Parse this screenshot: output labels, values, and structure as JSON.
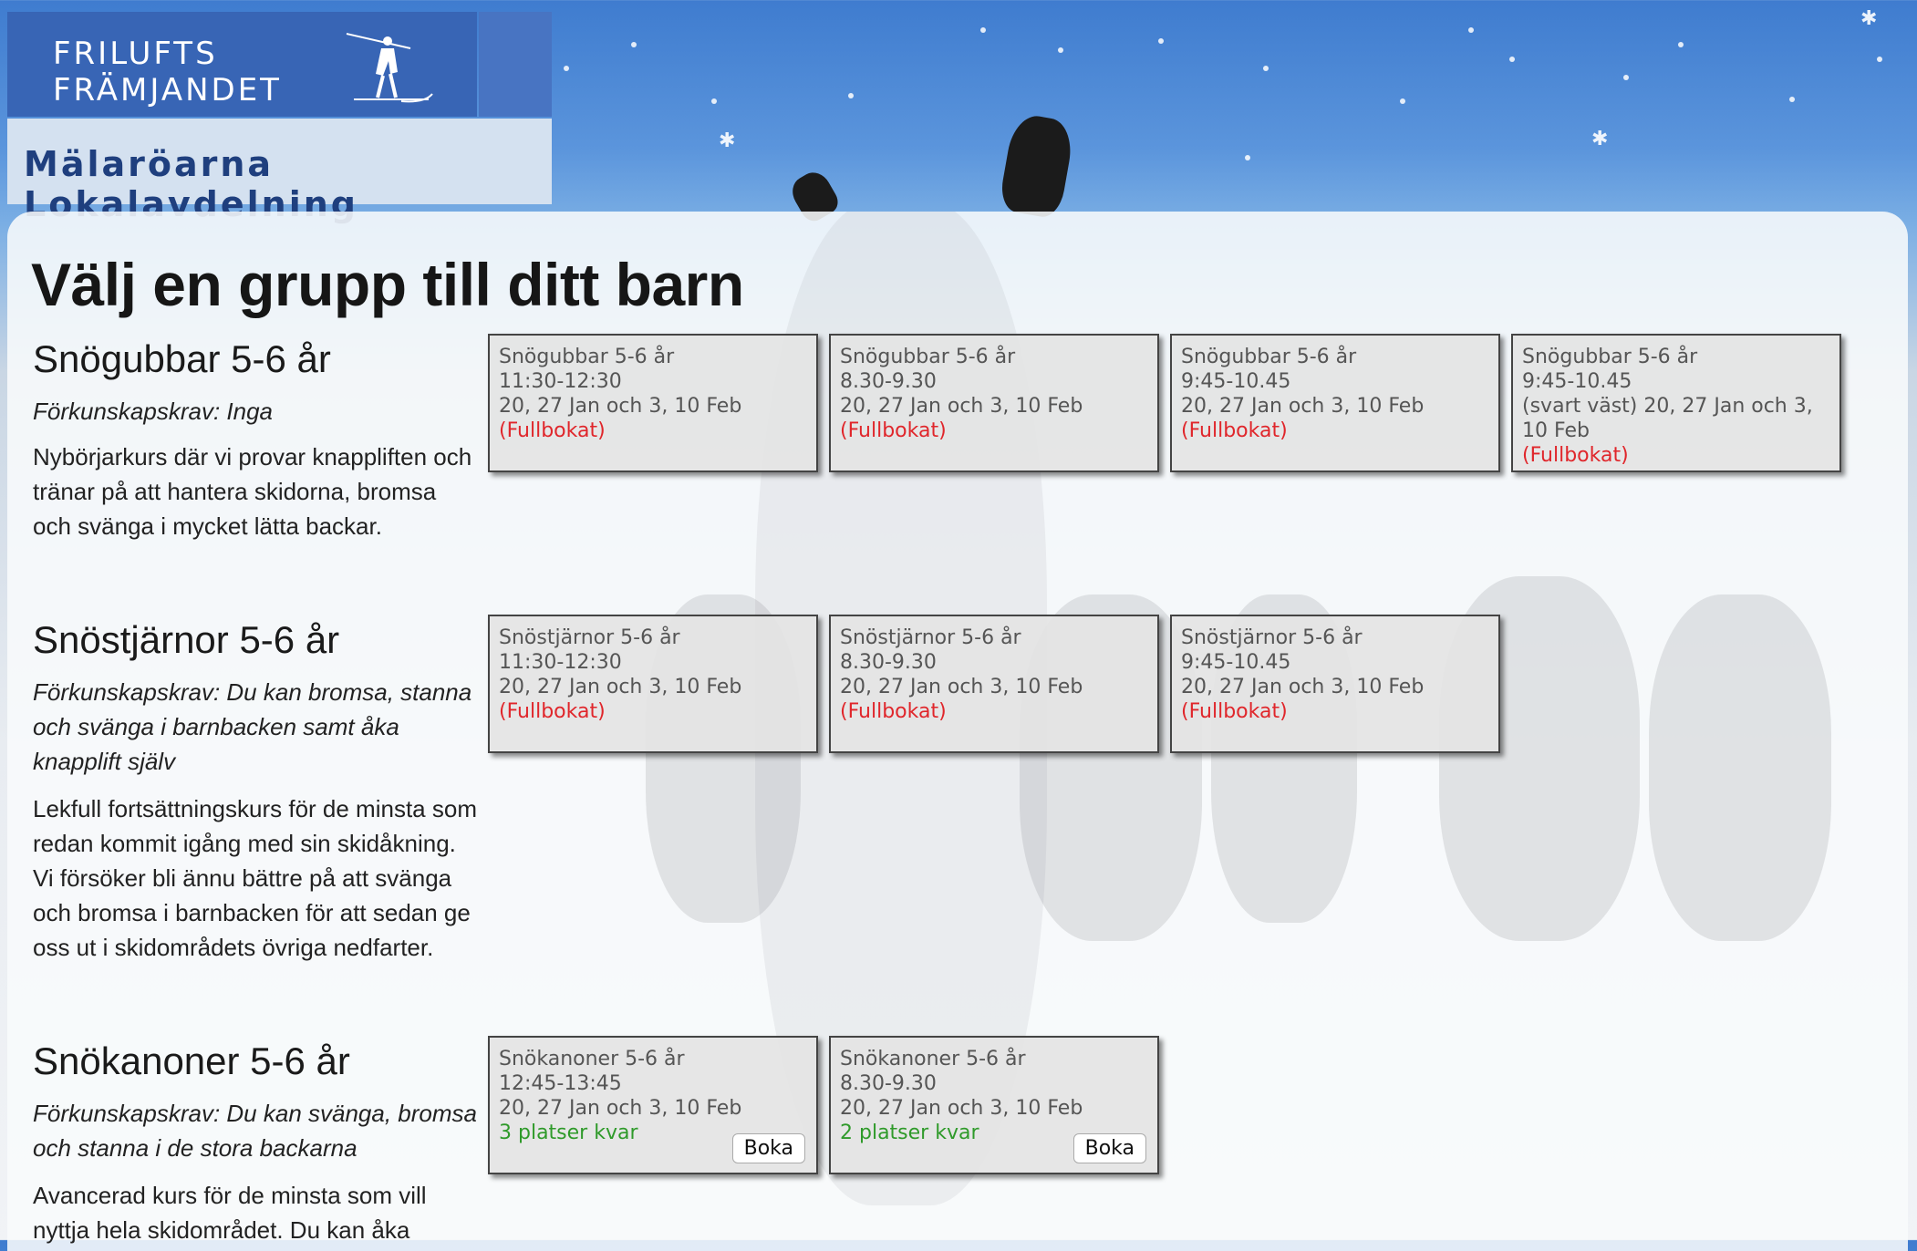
{
  "header": {
    "logo_line1": "FRILUFTS",
    "logo_line2": "FRÄMJANDET",
    "subtitle": "Mälaröarna Lokalavdelning"
  },
  "page": {
    "title": "Välj en grupp till ditt barn"
  },
  "courses": [
    {
      "title": "Snögubbar 5-6 år",
      "prereq": "Förkunskapskrav: Inga",
      "description": "Nybörjarkurs där vi provar knappliften och tränar på att hantera skidorna, bromsa och svänga i mycket lätta backar.",
      "groups": [
        {
          "name": "Snögubbar 5-6 år",
          "time": "11:30-12:30",
          "dates": "20, 27 Jan och 3, 10 Feb",
          "status": "(Fullbokat)"
        },
        {
          "name": "Snögubbar 5-6 år",
          "time": "8.30-9.30",
          "dates": "20, 27 Jan och 3, 10 Feb",
          "status": "(Fullbokat)"
        },
        {
          "name": "Snögubbar 5-6 år",
          "time": "9:45-10.45",
          "dates": "20, 27 Jan och 3, 10 Feb",
          "status": "(Fullbokat)"
        },
        {
          "name": "Snögubbar 5-6 år",
          "time": "9:45-10.45",
          "dates": "(svart väst) 20, 27 Jan och 3, 10 Feb",
          "status": "(Fullbokat)"
        }
      ]
    },
    {
      "title": "Snöstjärnor 5-6 år",
      "prereq": "Förkunskapskrav: Du kan bromsa, stanna och svänga i barnbacken samt åka knapplift själv",
      "description": "Lekfull fortsättningskurs för de minsta som redan kommit igång med sin skidåkning. Vi försöker bli ännu bättre på att svänga och bromsa i barnbacken för att sedan ge oss ut i skidområdets övriga nedfarter.",
      "groups": [
        {
          "name": "Snöstjärnor 5-6 år",
          "time": "11:30-12:30",
          "dates": "20, 27 Jan och 3, 10 Feb",
          "status": "(Fullbokat)"
        },
        {
          "name": "Snöstjärnor 5-6 år",
          "time": "8.30-9.30",
          "dates": "20, 27 Jan och 3, 10 Feb",
          "status": "(Fullbokat)"
        },
        {
          "name": "Snöstjärnor 5-6 år",
          "time": "9:45-10.45",
          "dates": "20, 27 Jan och 3, 10 Feb",
          "status": "(Fullbokat)"
        }
      ]
    },
    {
      "title": "Snökanoner 5-6 år",
      "prereq": "Förkunskapskrav: Du kan svänga, bromsa och stanna i de stora backarna",
      "description": "Avancerad kurs för de minsta som vill nyttja hela skidområdet. Du kan åka",
      "groups": [
        {
          "name": "Snökanoner 5-6 år",
          "time": "12:45-13:45",
          "dates": "20, 27 Jan och 3, 10 Feb",
          "status": "3 platser kvar",
          "button": "Boka"
        },
        {
          "name": "Snökanoner 5-6 år",
          "time": "8.30-9.30",
          "dates": "20, 27 Jan och 3, 10 Feb",
          "status": "2 platser kvar",
          "button": "Boka"
        }
      ]
    }
  ],
  "colors": {
    "status_full": "#e0262b",
    "status_free": "#2f9a2a",
    "logo_blue": "#3865b5",
    "subtitle_text": "#1f3f7e"
  }
}
